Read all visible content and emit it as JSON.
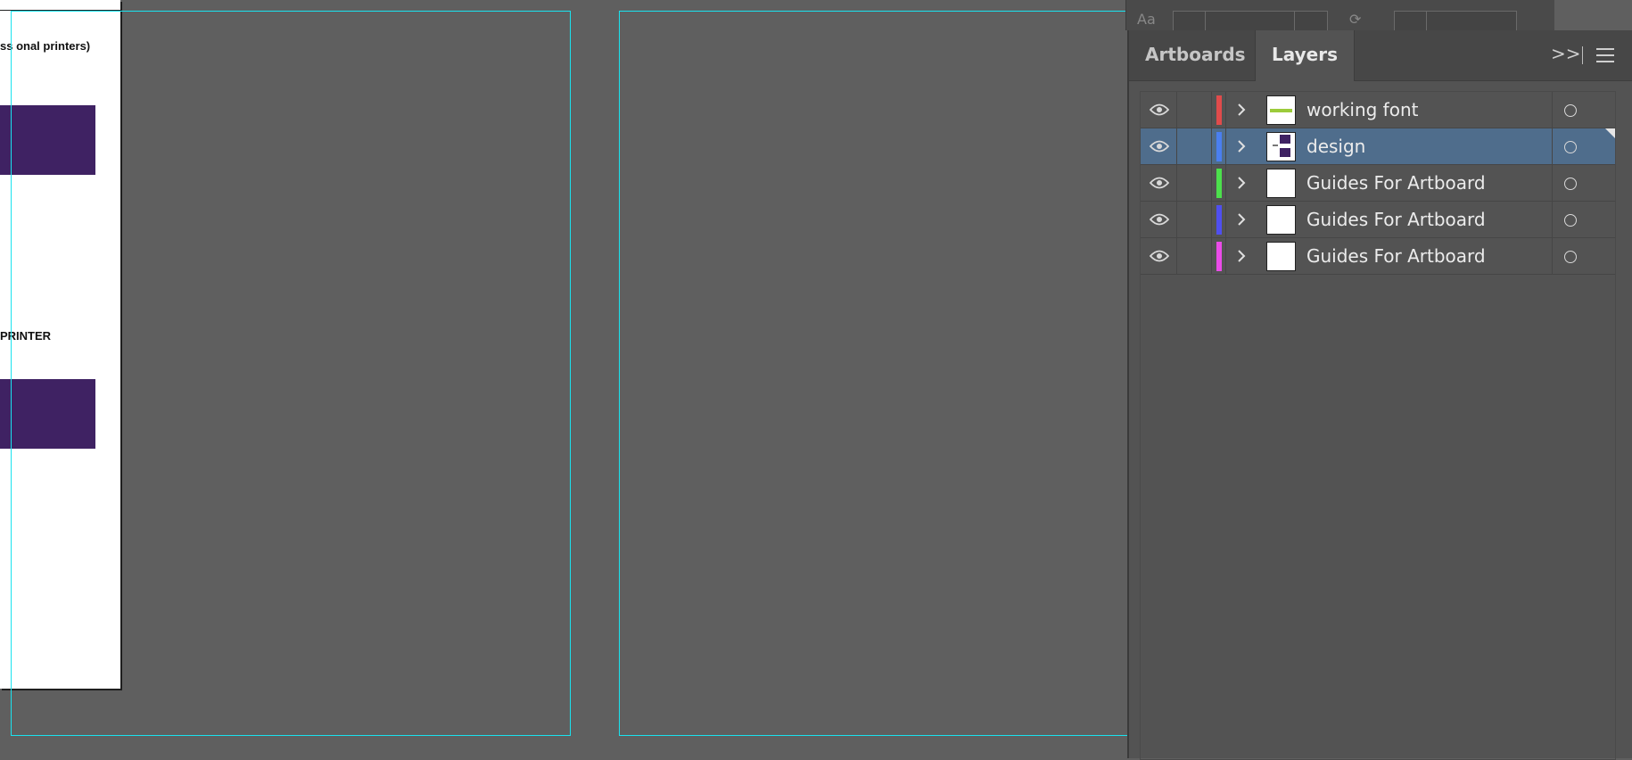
{
  "canvas": {
    "document_text_1": "ss onal printers)",
    "document_text_2": "PRINTER",
    "block_color": "#3f2263",
    "guide_color": "#19e3ef"
  },
  "panel": {
    "tabs": [
      {
        "label": "Artboards",
        "active": false
      },
      {
        "label": "Layers",
        "active": true
      }
    ],
    "collapse_icon": "double-chevron-right-icon",
    "menu_icon": "hamburger-menu-icon",
    "layers": [
      {
        "name": "working font",
        "color": "#e04b4b",
        "selected": false,
        "visible": true
      },
      {
        "name": "design",
        "color": "#4a7ff0",
        "selected": true,
        "visible": true
      },
      {
        "name": "Guides For Artboard",
        "color": "#4ce04c",
        "selected": false,
        "visible": true
      },
      {
        "name": "Guides For Artboard",
        "color": "#4f4ff0",
        "selected": false,
        "visible": true
      },
      {
        "name": "Guides For Artboard",
        "color": "#ea4be8",
        "selected": false,
        "visible": true
      }
    ]
  },
  "colors": {
    "canvas_bg": "#5f5f5f",
    "panel_bg": "#535353",
    "selection": "#4f6d8c"
  }
}
